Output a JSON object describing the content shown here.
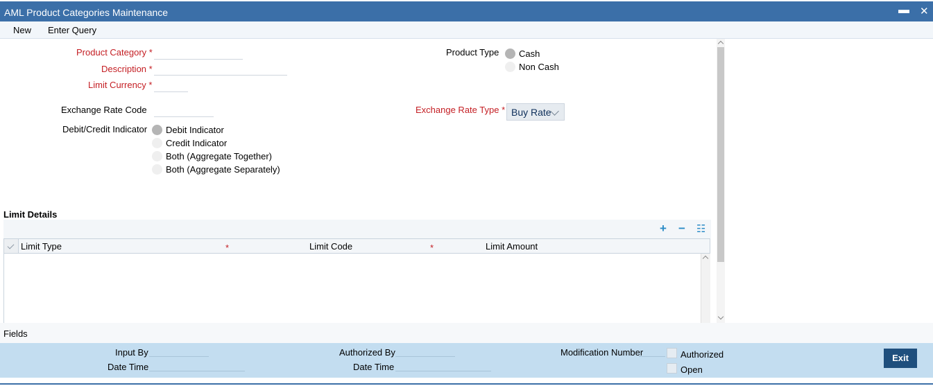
{
  "window": {
    "title": "AML Product Categories Maintenance"
  },
  "menu": {
    "new": "New",
    "enter_query": "Enter Query"
  },
  "form": {
    "product_category_label": "Product Category",
    "description_label": "Description",
    "limit_currency_label": "Limit Currency",
    "required_marker": "*",
    "product_type_label": "Product Type",
    "product_type_options": [
      {
        "label": "Cash",
        "selected": true
      },
      {
        "label": "Non Cash",
        "selected": false
      }
    ],
    "exchange_rate_code_label": "Exchange Rate Code",
    "exchange_rate_type_label": "Exchange Rate Type",
    "exchange_rate_type_value": "Buy Rate",
    "debit_credit_label": "Debit/Credit Indicator",
    "debit_credit_options": [
      {
        "label": "Debit Indicator",
        "selected": true
      },
      {
        "label": "Credit Indicator",
        "selected": false
      },
      {
        "label": "Both (Aggregate Together)",
        "selected": false
      },
      {
        "label": "Both (Aggregate Separately)",
        "selected": false
      }
    ]
  },
  "limit_details": {
    "title": "Limit Details",
    "toolbar": {
      "add": "+",
      "remove": "−",
      "list": "☷"
    },
    "columns": [
      "Limit Type",
      "Limit Code",
      "Limit Amount"
    ],
    "required_marker": "*"
  },
  "fields_bar": {
    "label": "Fields"
  },
  "footer": {
    "input_by": "Input By",
    "date_time": "Date Time",
    "authorized_by": "Authorized By",
    "date_time_2": "Date Time",
    "modification_number": "Modification Number",
    "authorized": "Authorized",
    "open": "Open",
    "exit": "Exit"
  },
  "colors": {
    "titlebar": "#3b6fa8",
    "required": "#c41e23",
    "footer": "#c3ddf0",
    "exit_button": "#1f4f7d",
    "toolbar_icon": "#2a8bc6"
  }
}
